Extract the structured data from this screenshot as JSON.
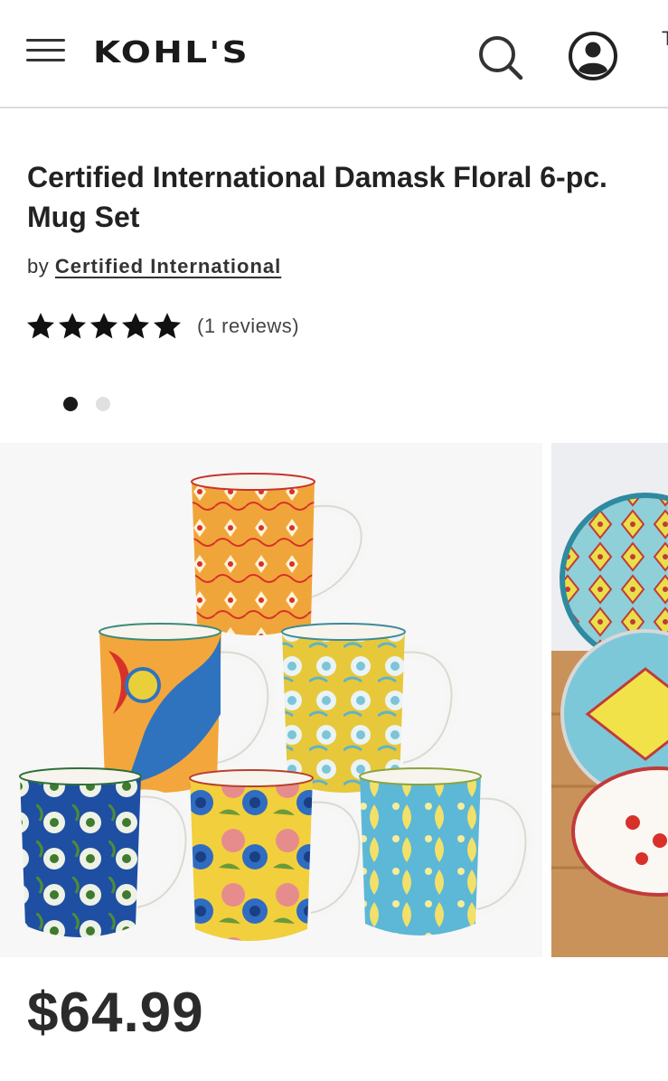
{
  "header": {
    "logo_text": "KOHL'S",
    "menu_icon": "hamburger-menu-icon",
    "search_icon": "search-icon",
    "account_icon": "account-icon"
  },
  "product": {
    "title_line1": "Certified International Damask Floral 6-pc.",
    "title_line2": "Mug Set",
    "by_label": "by",
    "brand": "Certified International",
    "rating": 5,
    "rating_max": 5,
    "reviews_label": "(1 reviews)",
    "price": "$64.99"
  },
  "carousel": {
    "slide_count": 2,
    "active_index": 0
  },
  "colors": {
    "text": "#222222",
    "star": "#111111",
    "active_dot": "#1a1a1a",
    "inactive_dot": "#e0e0e0",
    "divider": "#dcdcdc"
  }
}
